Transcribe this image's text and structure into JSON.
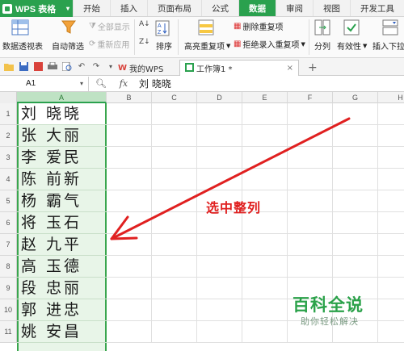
{
  "app": {
    "name": "WPS 表格",
    "caret": "▾"
  },
  "menu_tabs": [
    "开始",
    "插入",
    "页面布局",
    "公式",
    "数据",
    "审阅",
    "视图",
    "开发工具"
  ],
  "active_menu_tab": "数据",
  "ribbon": {
    "pivot_table": "数据透视表",
    "auto_filter": "自动筛选",
    "show_all": "全部显示",
    "reapply": "重新应用",
    "sort": "排序",
    "highlight_dup": "高亮重复项",
    "remove_dup": "删除重复项",
    "reject_dup": "拒绝录入重复项",
    "split": "分列",
    "validity": "有效性",
    "insert_dropdown": "插入下拉列"
  },
  "doc_tabs": {
    "wps_tab": "我的WPS",
    "workbook_tab": "工作簿1 *",
    "add_tab": "+"
  },
  "formula_bar": {
    "name_box": "A1",
    "fx": "fx",
    "value": "刘  晓晓"
  },
  "columns": [
    "A",
    "B",
    "C",
    "D",
    "E",
    "F",
    "G",
    "H"
  ],
  "rows": [
    "1",
    "2",
    "3",
    "4",
    "5",
    "6",
    "7",
    "8",
    "9",
    "10",
    "11"
  ],
  "column_a_values": [
    "刘 晓晓",
    "张 大丽",
    "李 爱民",
    "陈 前新",
    "杨 霸气",
    "将 玉石",
    "赵 九平",
    "高 玉德",
    "段 忠丽",
    "郭 进忠",
    "姚 安昌"
  ],
  "annotation": {
    "text": "选中整列",
    "color": "#e02020"
  },
  "watermark": {
    "title": "百科全说",
    "subtitle": "助你轻松解决"
  },
  "colors": {
    "accent": "#2aa14e",
    "selection_fill": "#e8f5e8"
  }
}
